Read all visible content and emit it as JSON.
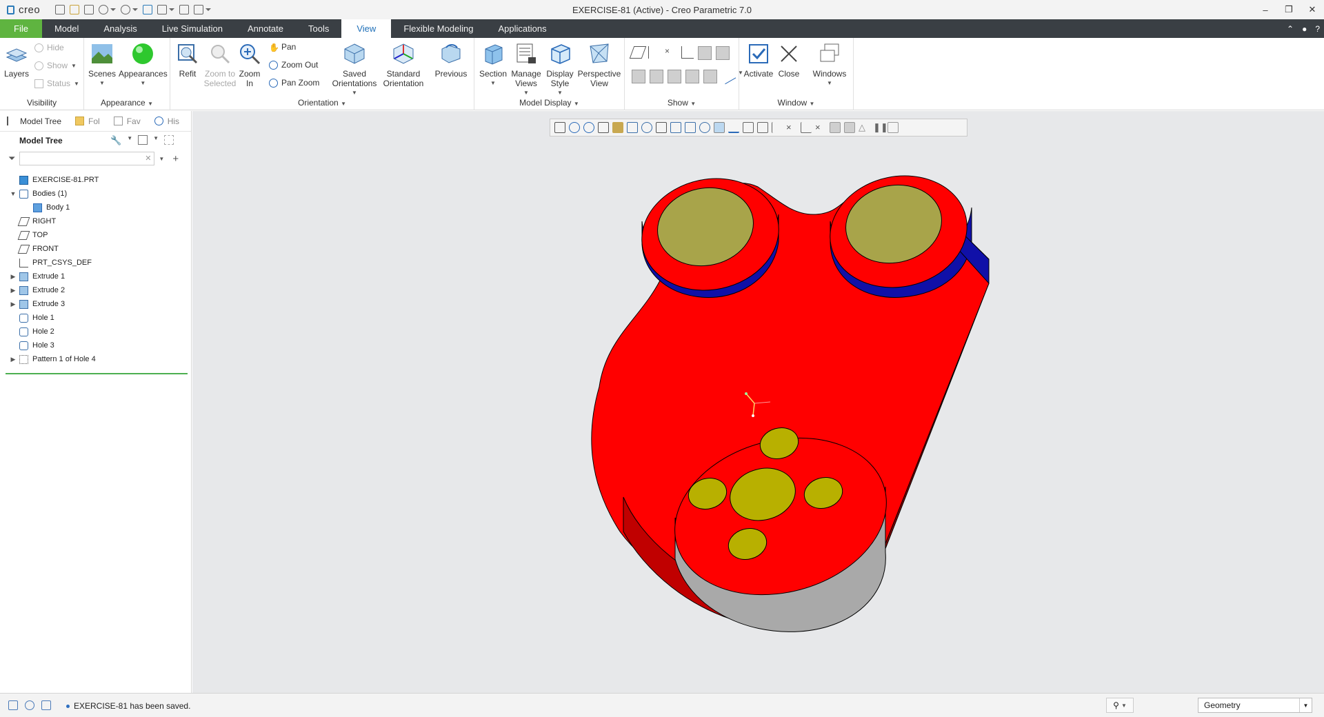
{
  "app": {
    "logo_text": "creo",
    "window_title": "EXERCISE-81 (Active) - Creo Parametric 7.0",
    "win_controls": [
      "–",
      "❐",
      "✕"
    ]
  },
  "ribbon_tabs": [
    "File",
    "Model",
    "Analysis",
    "Live Simulation",
    "Annotate",
    "Tools",
    "View",
    "Flexible Modeling",
    "Applications"
  ],
  "active_tab": "View",
  "ribbon": {
    "visibility": {
      "label": "Visibility",
      "layers": "Layers",
      "hide": "Hide",
      "show": "Show",
      "status": "Status"
    },
    "appearance": {
      "label": "Appearance",
      "scenes": "Scenes",
      "appearances": "Appearances"
    },
    "orientation": {
      "label": "Orientation",
      "refit": "Refit",
      "zoom_selected": "Zoom to Selected",
      "zoom_in": "Zoom In",
      "pan": "Pan",
      "zoom_out": "Zoom Out",
      "pan_zoom": "Pan Zoom",
      "saved_orientations": "Saved Orientations",
      "standard_orientation": "Standard Orientation",
      "previous": "Previous"
    },
    "model_display": {
      "label": "Model Display",
      "section": "Section",
      "manage_views": "Manage Views",
      "display_style": "Display Style",
      "perspective_view": "Perspective View"
    },
    "show": {
      "label": "Show"
    },
    "window": {
      "label": "Window",
      "activate": "Activate",
      "close": "Close",
      "windows": "Windows"
    }
  },
  "panel_tabs": [
    "Model Tree",
    "Fol",
    "Fav",
    "His"
  ],
  "model_tree": {
    "title": "Model Tree",
    "search_placeholder": "",
    "nodes": [
      {
        "label": "EXERCISE-81.PRT",
        "indent": 0,
        "expander": "",
        "icon": "part-icon"
      },
      {
        "label": "Bodies (1)",
        "indent": 0,
        "expander": "▼",
        "icon": "bodies-icon"
      },
      {
        "label": "Body 1",
        "indent": 1,
        "expander": "",
        "icon": "body-icon"
      },
      {
        "label": "RIGHT",
        "indent": 0,
        "expander": "",
        "icon": "datum-plane-icon"
      },
      {
        "label": "TOP",
        "indent": 0,
        "expander": "",
        "icon": "datum-plane-icon"
      },
      {
        "label": "FRONT",
        "indent": 0,
        "expander": "",
        "icon": "datum-plane-icon"
      },
      {
        "label": "PRT_CSYS_DEF",
        "indent": 0,
        "expander": "",
        "icon": "csys-icon"
      },
      {
        "label": "Extrude 1",
        "indent": 0,
        "expander": "▶",
        "icon": "extrude-icon"
      },
      {
        "label": "Extrude 2",
        "indent": 0,
        "expander": "▶",
        "icon": "extrude-icon"
      },
      {
        "label": "Extrude 3",
        "indent": 0,
        "expander": "▶",
        "icon": "extrude-icon"
      },
      {
        "label": "Hole 1",
        "indent": 0,
        "expander": "",
        "icon": "hole-icon"
      },
      {
        "label": "Hole 2",
        "indent": 0,
        "expander": "",
        "icon": "hole-icon"
      },
      {
        "label": "Hole 3",
        "indent": 0,
        "expander": "",
        "icon": "hole-icon"
      },
      {
        "label": "Pattern 1 of Hole 4",
        "indent": 0,
        "expander": "▶",
        "icon": "pattern-icon"
      }
    ]
  },
  "status": {
    "message": "EXERCISE-81 has been saved.",
    "filter_value": "Geometry"
  },
  "colors": {
    "part_red": "#ff0000",
    "part_dark_red": "#8a0000",
    "hole_olive": "#b8b000",
    "rim_blue": "#1010a8",
    "boss_gray": "#a8a8a8",
    "file_tab_green": "#5fb440",
    "active_tab_blue": "#1e6fb8"
  }
}
